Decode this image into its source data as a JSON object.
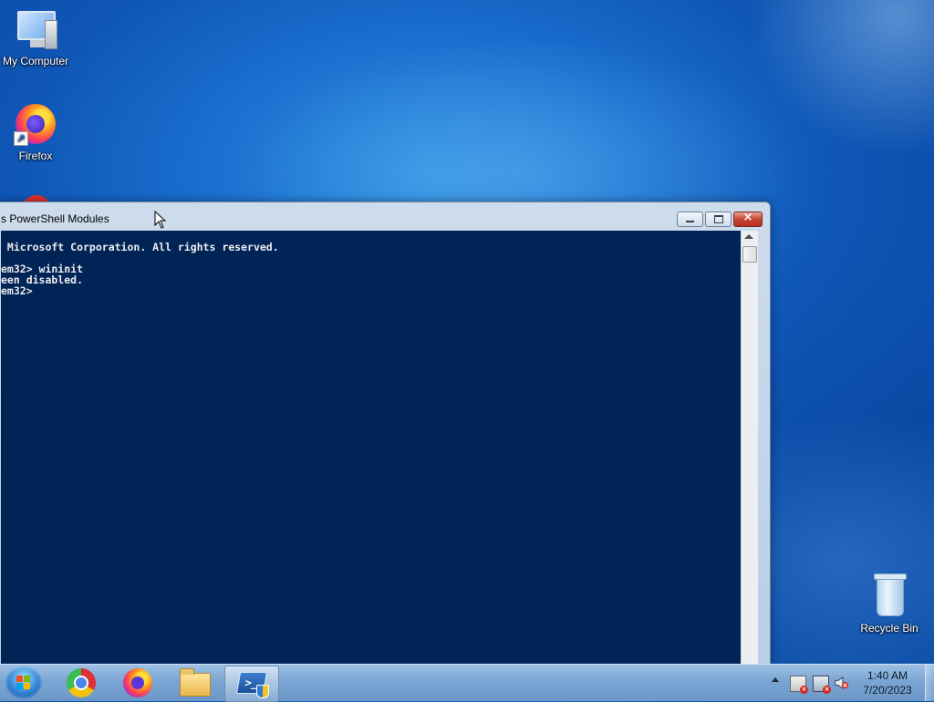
{
  "desktop": {
    "icons": [
      {
        "label": "My Computer",
        "icon": "computer-icon"
      },
      {
        "label": "Firefox",
        "icon": "firefox-icon"
      },
      {
        "label": "Recycle Bin",
        "icon": "recycle-bin-icon"
      }
    ],
    "colors": {
      "background": "#0f56b6"
    }
  },
  "window": {
    "title": "s PowerShell Modules",
    "console_lines": [
      " Microsoft Corporation. All rights reserved.",
      "",
      "em32> wininit",
      "een disabled.",
      "em32>"
    ],
    "colors": {
      "console_bg": "#012456",
      "console_fg": "#eeedf0"
    },
    "buttons": {
      "minimize": "minimize-icon",
      "maximize": "maximize-icon",
      "close": "close-icon"
    }
  },
  "taskbar": {
    "start_icon": "windows-logo-icon",
    "pinned": [
      {
        "name": "chrome",
        "icon": "chrome-icon"
      },
      {
        "name": "firefox",
        "icon": "firefox-icon"
      },
      {
        "name": "explorer",
        "icon": "folder-icon"
      },
      {
        "name": "powershell",
        "icon": "powershell-icon",
        "active": true
      }
    ],
    "tray": {
      "icons": [
        "show-hidden-icons-arrow",
        "action-center-flag-icon",
        "network-icon",
        "volume-muted-icon"
      ],
      "time": "1:40 AM",
      "date": "7/20/2023"
    }
  }
}
